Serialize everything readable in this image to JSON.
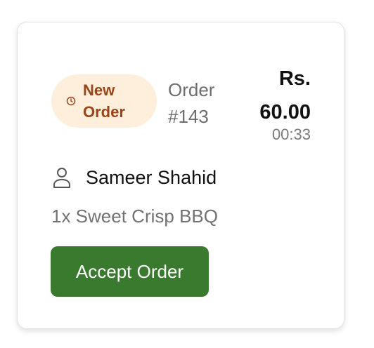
{
  "order_card": {
    "status_badge": {
      "label": "New Order",
      "icon": "clock-icon",
      "bg_color": "#fdefdc",
      "text_color": "#9a4419"
    },
    "order_number": "Order #143",
    "price": "Rs. 60.00",
    "elapsed_time": "00:33",
    "customer": {
      "icon": "user-icon",
      "name": "Sameer Shahid"
    },
    "items_summary": "1x Sweet Crisp BBQ",
    "accept_button": {
      "label": "Accept Order",
      "bg_color": "#3a7a2e"
    }
  }
}
